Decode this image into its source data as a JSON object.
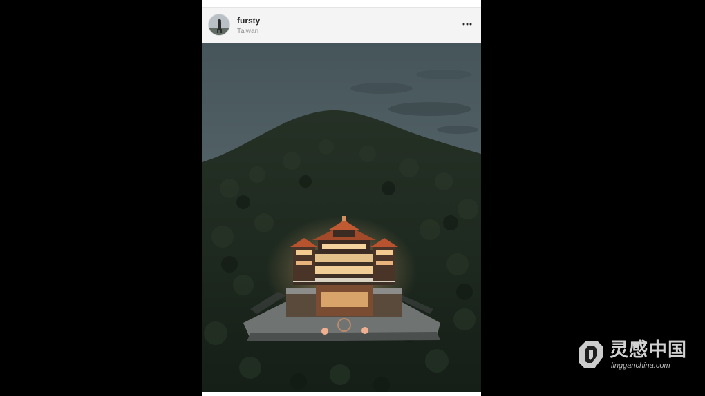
{
  "post": {
    "username": "fursty",
    "location": "Taiwan",
    "avatar_icon": "profile-photo",
    "more_icon": "more-options-icon",
    "photo_subject": "temple-on-mountain-photo"
  },
  "watermark": {
    "title": "灵感中国",
    "url": "lingganchina.com",
    "logo_icon": "lingganchina-logo"
  },
  "colors": {
    "background": "#000000",
    "card": "#f4f4f4",
    "username": "#262626",
    "location": "#8e8e8e",
    "sky": "#4d5b60",
    "mountain": "#1f2a21"
  }
}
